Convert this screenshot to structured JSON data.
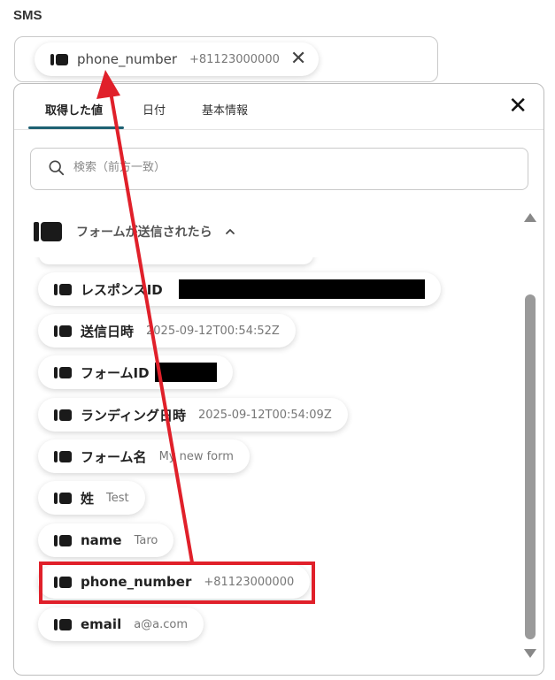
{
  "field": {
    "label": "SMS",
    "chip": {
      "label": "phone_number",
      "value": "+81123000000",
      "close_icon": "close-icon"
    }
  },
  "panel": {
    "tabs": [
      {
        "label": "取得した値",
        "active": true
      },
      {
        "label": "日付",
        "active": false
      },
      {
        "label": "基本情報",
        "active": false
      }
    ],
    "search": {
      "placeholder": "検索（前方一致）"
    },
    "group": {
      "title": "フォームが送信されたら",
      "expanded": true
    },
    "items": [
      {
        "label": "レスポンスID",
        "value": "",
        "redacted": true
      },
      {
        "label": "送信日時",
        "value": "2025-09-12T00:54:52Z"
      },
      {
        "label": "フォームID",
        "value": "",
        "redacted": true
      },
      {
        "label": "ランディング日時",
        "value": "2025-09-12T00:54:09Z"
      },
      {
        "label": "フォーム名",
        "value": "My new form"
      },
      {
        "label": "姓",
        "value": "Test"
      },
      {
        "label": "name",
        "value": "Taro"
      },
      {
        "label": "phone_number",
        "value": "+81123000000",
        "highlighted": true
      },
      {
        "label": "email",
        "value": "a@a.com"
      }
    ]
  },
  "annotation": {
    "arrow_color": "#e0202a",
    "box_color": "#e0202a"
  },
  "colors": {
    "tab_underline": "#1e6173",
    "scroll_thumb": "#9a9a9a"
  }
}
